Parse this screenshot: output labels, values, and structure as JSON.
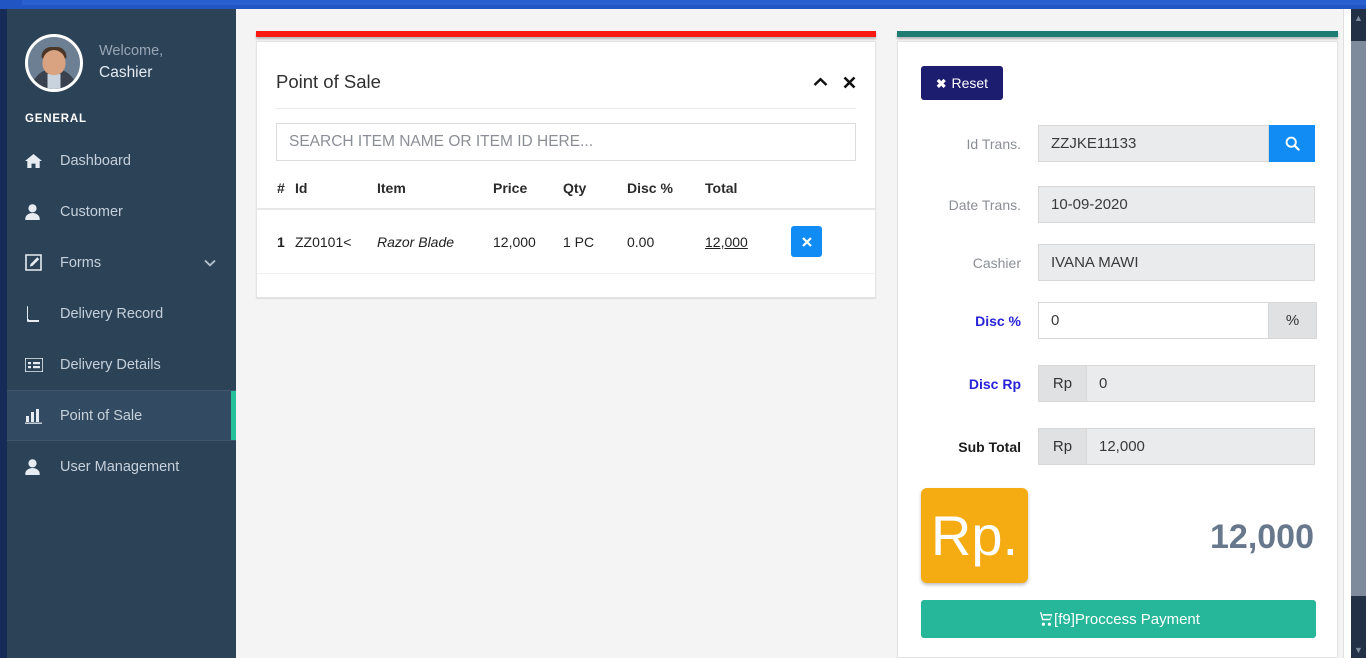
{
  "sidebar": {
    "welcome_line1": "Welcome,",
    "welcome_line2": "Cashier",
    "section_title": "GENERAL",
    "items": [
      {
        "label": "Dashboard",
        "icon": "home-icon",
        "active": false,
        "caret": ""
      },
      {
        "label": "Customer",
        "icon": "user-icon",
        "active": false,
        "caret": ""
      },
      {
        "label": "Forms",
        "icon": "edit-square-icon",
        "active": false,
        "caret": "⌄"
      },
      {
        "label": "Delivery Record",
        "icon": "book-icon",
        "active": false,
        "caret": ""
      },
      {
        "label": "Delivery Details",
        "icon": "list-icon",
        "active": false,
        "caret": ""
      },
      {
        "label": "Point of Sale",
        "icon": "bar-chart-icon",
        "active": true,
        "caret": ""
      },
      {
        "label": "User Management",
        "icon": "user-icon",
        "active": false,
        "caret": ""
      }
    ]
  },
  "pos_card": {
    "title": "Point of Sale",
    "collapse_icon": "chevron-up-icon",
    "close_icon": "close-icon",
    "search_placeholder": "SEARCH ITEM NAME OR ITEM ID HERE...",
    "search_value": "",
    "columns": [
      "#",
      "Id",
      "Item",
      "Price",
      "Qty",
      "Disc %",
      "Total",
      ""
    ],
    "rows": [
      {
        "num": "1",
        "id": "ZZ0101<",
        "item": "Razor Blade",
        "price": "12,000",
        "qty": "1 PC",
        "disc": "0.00",
        "total": "12,000",
        "delete_label": "✖"
      }
    ]
  },
  "payment_card": {
    "reset_label": "Reset",
    "reset_icon": "close-icon",
    "search_icon": "search-icon",
    "fields": [
      {
        "label": "Id Trans.",
        "value": "ZZJKE11133",
        "label_style": "muted"
      },
      {
        "label": "Date Trans.",
        "value": "10-09-2020",
        "label_style": "muted"
      },
      {
        "label": "Cashier",
        "value": "IVANA MAWI",
        "label_style": "muted"
      }
    ],
    "disc_percent": {
      "label": "Disc %",
      "value": "0",
      "addon": "%"
    },
    "disc_rp": {
      "label": "Disc Rp",
      "value": "0",
      "addon": "Rp"
    },
    "sub_total": {
      "label": "Sub Total",
      "value": "12,000",
      "addon": "Rp"
    },
    "currency_badge": "Rp.",
    "grand_total": "12,000",
    "pay_button_label": "[f9]Proccess Payment",
    "pay_button_icon": "shopping-cart-icon"
  },
  "scrollbar": {
    "up": "▲",
    "down": "▼"
  },
  "colors": {
    "sidebar_bg": "#2b4257",
    "accent_teal": "#27c29b",
    "pos_topbar_red": "#f91b13",
    "pay_topbar_teal": "#1d7d72",
    "link_blue": "#2822d8",
    "btn_blue": "#108cf4",
    "reset_navy": "#1c1d6e",
    "badge_orange": "#f5ab12",
    "pay_green": "#26b699",
    "total_slate": "#68788c"
  }
}
